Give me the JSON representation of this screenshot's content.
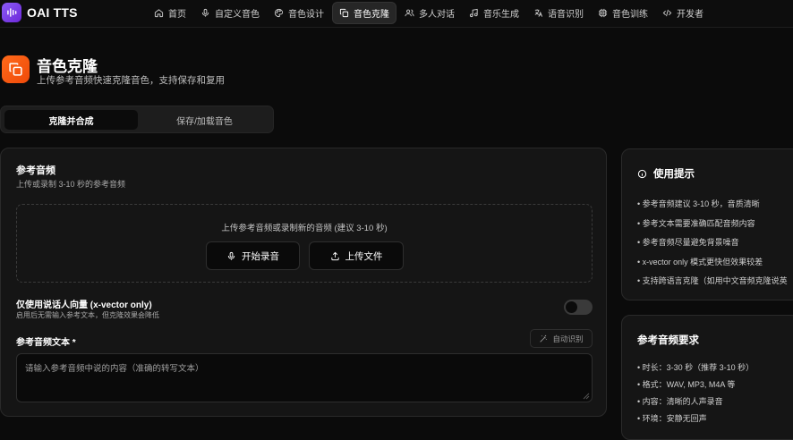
{
  "app": {
    "brand": "OAI TTS"
  },
  "nav": {
    "items": [
      {
        "label": "首页",
        "icon": "home-icon"
      },
      {
        "label": "自定义音色",
        "icon": "mic-icon"
      },
      {
        "label": "音色设计",
        "icon": "palette-icon"
      },
      {
        "label": "音色克隆",
        "icon": "copy-icon",
        "active": true
      },
      {
        "label": "多人对话",
        "icon": "users-icon"
      },
      {
        "label": "音乐生成",
        "icon": "music-icon"
      },
      {
        "label": "语音识别",
        "icon": "languages-icon"
      },
      {
        "label": "音色训练",
        "icon": "cpu-icon"
      },
      {
        "label": "开发者",
        "icon": "code-icon"
      }
    ]
  },
  "page": {
    "title": "音色克隆",
    "subtitle": "上传参考音频快速克隆音色，支持保存和复用"
  },
  "tabs": {
    "clone": "克隆并合成",
    "save": "保存/加载音色"
  },
  "reference": {
    "title": "参考音频",
    "subtitle": "上传或录制 3-10 秒的参考音频",
    "drop_hint": "上传参考音频或录制新的音频 (建议 3-10 秒)",
    "record_label": "开始录音",
    "upload_label": "上传文件"
  },
  "xvector": {
    "title": "仅使用说话人向量 (x-vector only)",
    "subtitle": "启用后无需输入参考文本，但克隆效果会降低",
    "enabled": false
  },
  "ref_text": {
    "label": "参考音频文本 *",
    "auto_label": "自动识别",
    "placeholder": "请输入参考音频中说的内容（准确的转写文本）"
  },
  "tips": {
    "title": "使用提示",
    "items": [
      "• 参考音频建议 3-10 秒，音质清晰",
      "• 参考文本需要准确匹配音频内容",
      "• 参考音频尽量避免背景噪音",
      "• x-vector only 模式更快但效果较差",
      "• 支持跨语言克隆（如用中文音频克隆说英"
    ]
  },
  "requirements": {
    "title": "参考音频要求",
    "items": [
      "• 时长：3-30 秒（推荐 3-10 秒）",
      "• 格式：WAV, MP3, M4A 等",
      "• 内容：清晰的人声录音",
      "• 环境：安静无回声"
    ]
  },
  "colors": {
    "brand_logo": "#7c3aed",
    "page_icon": "#f4511e",
    "background": "#0b0b0b",
    "card": "#151515"
  }
}
